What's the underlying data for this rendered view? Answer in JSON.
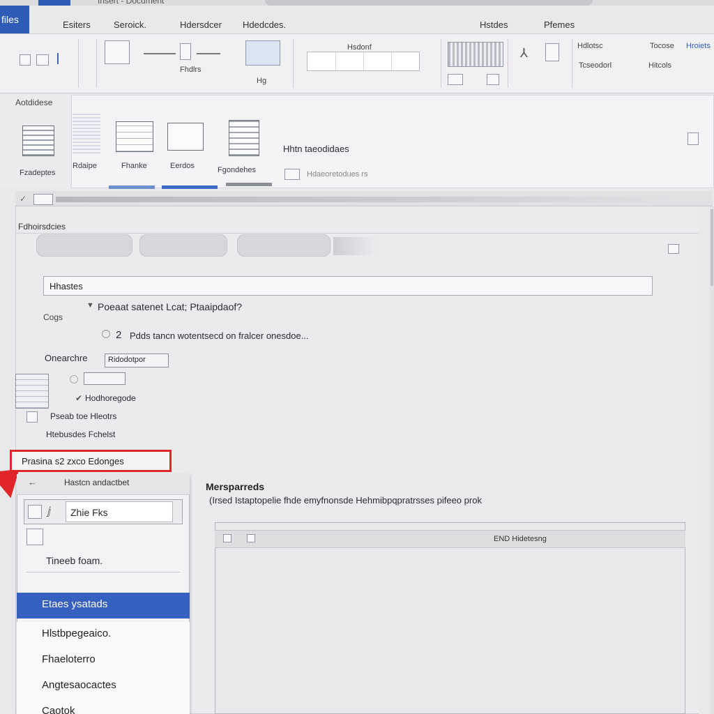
{
  "title_bar": {
    "file_name": "Insert - Document"
  },
  "file_tab": {
    "label": "ﬁles"
  },
  "tabs": [
    {
      "label": "Esiters"
    },
    {
      "label": "Seroick."
    },
    {
      "label": "Hdersdcer"
    },
    {
      "label": "Hdedcdes."
    },
    {
      "label": "Hstdes"
    },
    {
      "label": "Pfemes"
    }
  ],
  "ribbon": {
    "group_label_1": "Fhdlrs",
    "group_label_2": "Hg",
    "field_title": "Hsdonf",
    "right_labels": [
      "Hdlotsc",
      "Tocose",
      "Hroiets",
      "Tcseodorl",
      "Hitcols"
    ]
  },
  "panel": {
    "side_label": "Aotdidese",
    "gallery": [
      {
        "label": "Fzadeptes"
      },
      {
        "label": "Rdaipe"
      },
      {
        "label": "Fhanke"
      },
      {
        "label": "Eerdos"
      },
      {
        "label": "Fgondehes"
      }
    ],
    "heading": "Hhtn taeodidaes",
    "subheading": "Hdaeoretodues rs"
  },
  "doc": {
    "section_label": "Fdhoirsdcies",
    "search_value": "Hhastes",
    "option_label": "Poeaat satenet Lcat; Ptaaipdaof?",
    "side_caption": "Cogs",
    "number_badge": "2",
    "option_desc": "Pdds tancn wotentsecd on fralcer onesdoe...",
    "orientation_label": "Onearchre",
    "orientation_value": "Ridodotpor",
    "sub_item_1": "Hodhoregode",
    "sub_item_2": "Pseab toe Hleotrs",
    "sub_item_3": "Htebusdes Fchelst"
  },
  "highlight": {
    "label": "Prasina s2 zxco Edonges"
  },
  "dropdown": {
    "header": "Hastcn andactbet",
    "input_value": "Zhie Fks",
    "note": "Tineeb foam.",
    "items": [
      {
        "label": "Etaes ysatads"
      },
      {
        "label": "Hlstbpegeaico."
      },
      {
        "label": "Fhaeloterro"
      },
      {
        "label": "Angtesaocactes"
      },
      {
        "label": "Caotok"
      }
    ]
  },
  "content": {
    "title": "Mersparreds",
    "description": "(Irsed Istaptopelie fhde emyfnonsde Hehmibpqpratrsses pifeeo prok",
    "table_header": "END Hidetesng"
  }
}
